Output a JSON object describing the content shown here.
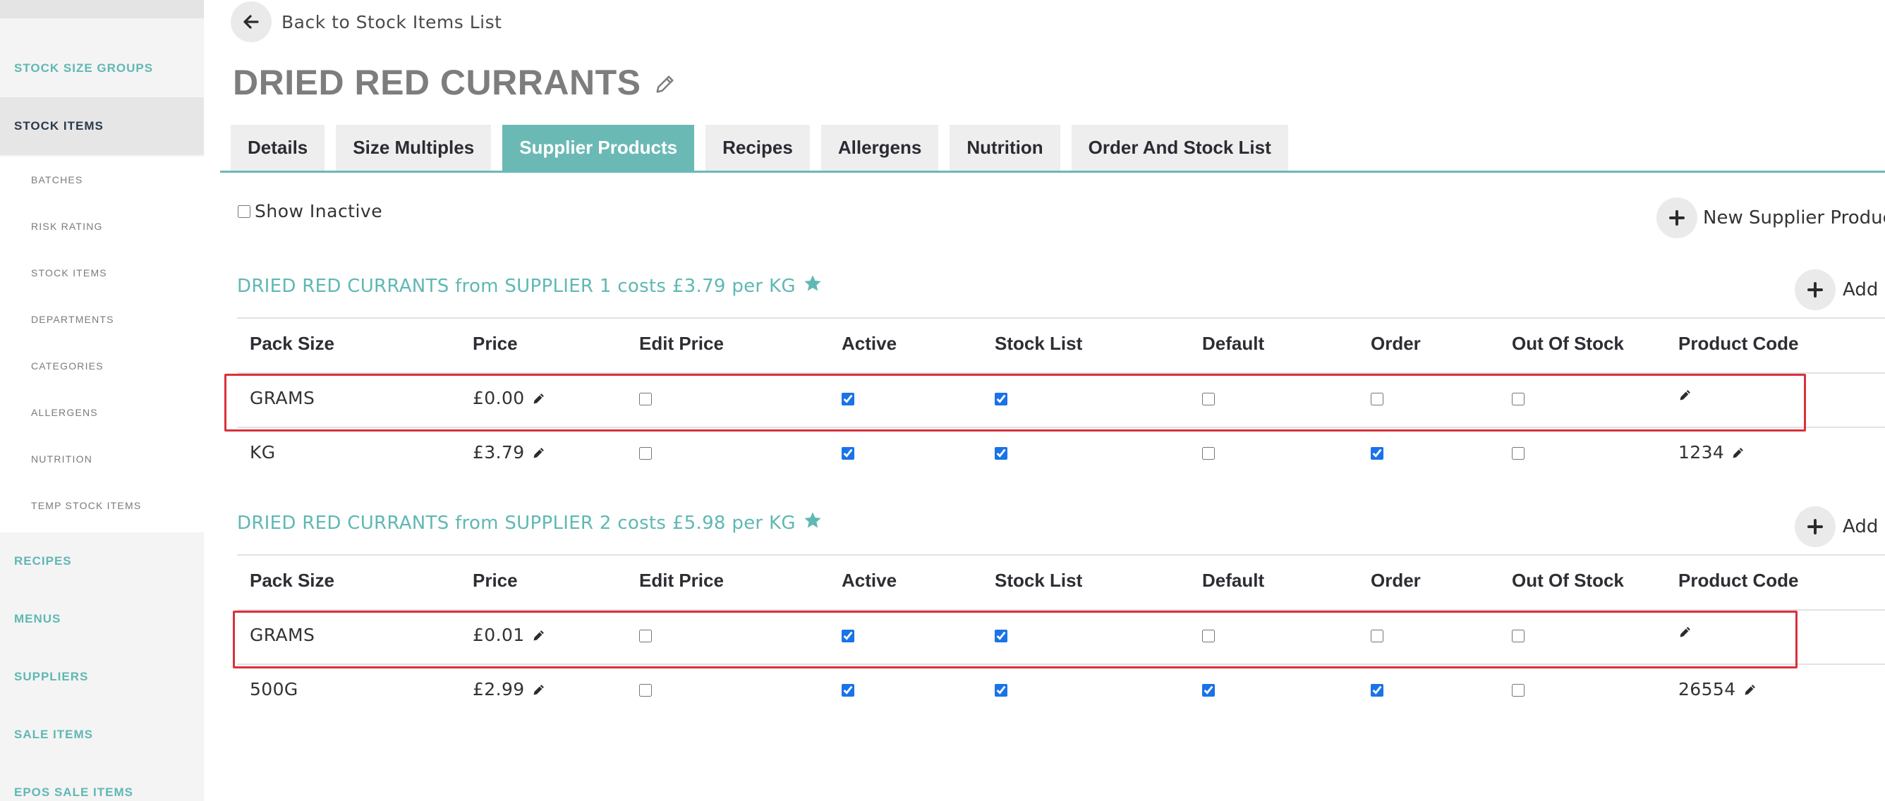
{
  "sidebar": {
    "items": [
      {
        "label": "STOCK SIZE GROUPS",
        "type": "main"
      },
      {
        "label": "STOCK ITEMS",
        "type": "main",
        "active": true
      },
      {
        "label": "BATCHES",
        "type": "sub"
      },
      {
        "label": "RISK RATING",
        "type": "sub"
      },
      {
        "label": "STOCK ITEMS",
        "type": "sub"
      },
      {
        "label": "DEPARTMENTS",
        "type": "sub"
      },
      {
        "label": "CATEGORIES",
        "type": "sub"
      },
      {
        "label": "ALLERGENS",
        "type": "sub"
      },
      {
        "label": "NUTRITION",
        "type": "sub"
      },
      {
        "label": "TEMP STOCK ITEMS",
        "type": "sub"
      },
      {
        "label": "RECIPES",
        "type": "main"
      },
      {
        "label": "MENUS",
        "type": "main"
      },
      {
        "label": "SUPPLIERS",
        "type": "main"
      },
      {
        "label": "SALE ITEMS",
        "type": "main"
      },
      {
        "label": "EPOS SALE ITEMS",
        "type": "main"
      }
    ]
  },
  "header": {
    "back_label": "Back to Stock Items List",
    "title": "DRIED RED CURRANTS"
  },
  "tabs": [
    {
      "label": "Details"
    },
    {
      "label": "Size Multiples"
    },
    {
      "label": "Supplier Products",
      "active": true
    },
    {
      "label": "Recipes"
    },
    {
      "label": "Allergens"
    },
    {
      "label": "Nutrition"
    },
    {
      "label": "Order And Stock List"
    }
  ],
  "controls": {
    "show_inactive_label": "Show Inactive",
    "show_inactive_checked": false,
    "new_supplier_product_label": "New Supplier Product",
    "add_label": "Add"
  },
  "columns": [
    "Pack Size",
    "Price",
    "Edit Price",
    "Active",
    "Stock List",
    "Default",
    "Order",
    "Out Of Stock",
    "Product Code"
  ],
  "groups": [
    {
      "title": "DRIED RED CURRANTS from SUPPLIER 1 costs £3.79 per KG",
      "rows": [
        {
          "pack_size": "GRAMS",
          "price": "£0.00",
          "edit_price": false,
          "active": true,
          "stock_list": true,
          "default": false,
          "order": false,
          "out_of_stock": false,
          "product_code": "",
          "highlighted": true
        },
        {
          "pack_size": "KG",
          "price": "£3.79",
          "edit_price": false,
          "active": true,
          "stock_list": true,
          "default": false,
          "order": true,
          "out_of_stock": false,
          "product_code": "1234",
          "highlighted": false
        }
      ]
    },
    {
      "title": "DRIED RED CURRANTS from SUPPLIER 2 costs £5.98 per KG",
      "rows": [
        {
          "pack_size": "GRAMS",
          "price": "£0.01",
          "edit_price": false,
          "active": true,
          "stock_list": true,
          "default": false,
          "order": false,
          "out_of_stock": false,
          "product_code": "",
          "highlighted": true
        },
        {
          "pack_size": "500G",
          "price": "£2.99",
          "edit_price": false,
          "active": true,
          "stock_list": true,
          "default": true,
          "order": true,
          "out_of_stock": false,
          "product_code": "26554",
          "highlighted": false
        }
      ]
    }
  ],
  "colors": {
    "accent": "#6bb9b5",
    "highlight": "#d9313a",
    "checkbox": "#1a73e8"
  }
}
